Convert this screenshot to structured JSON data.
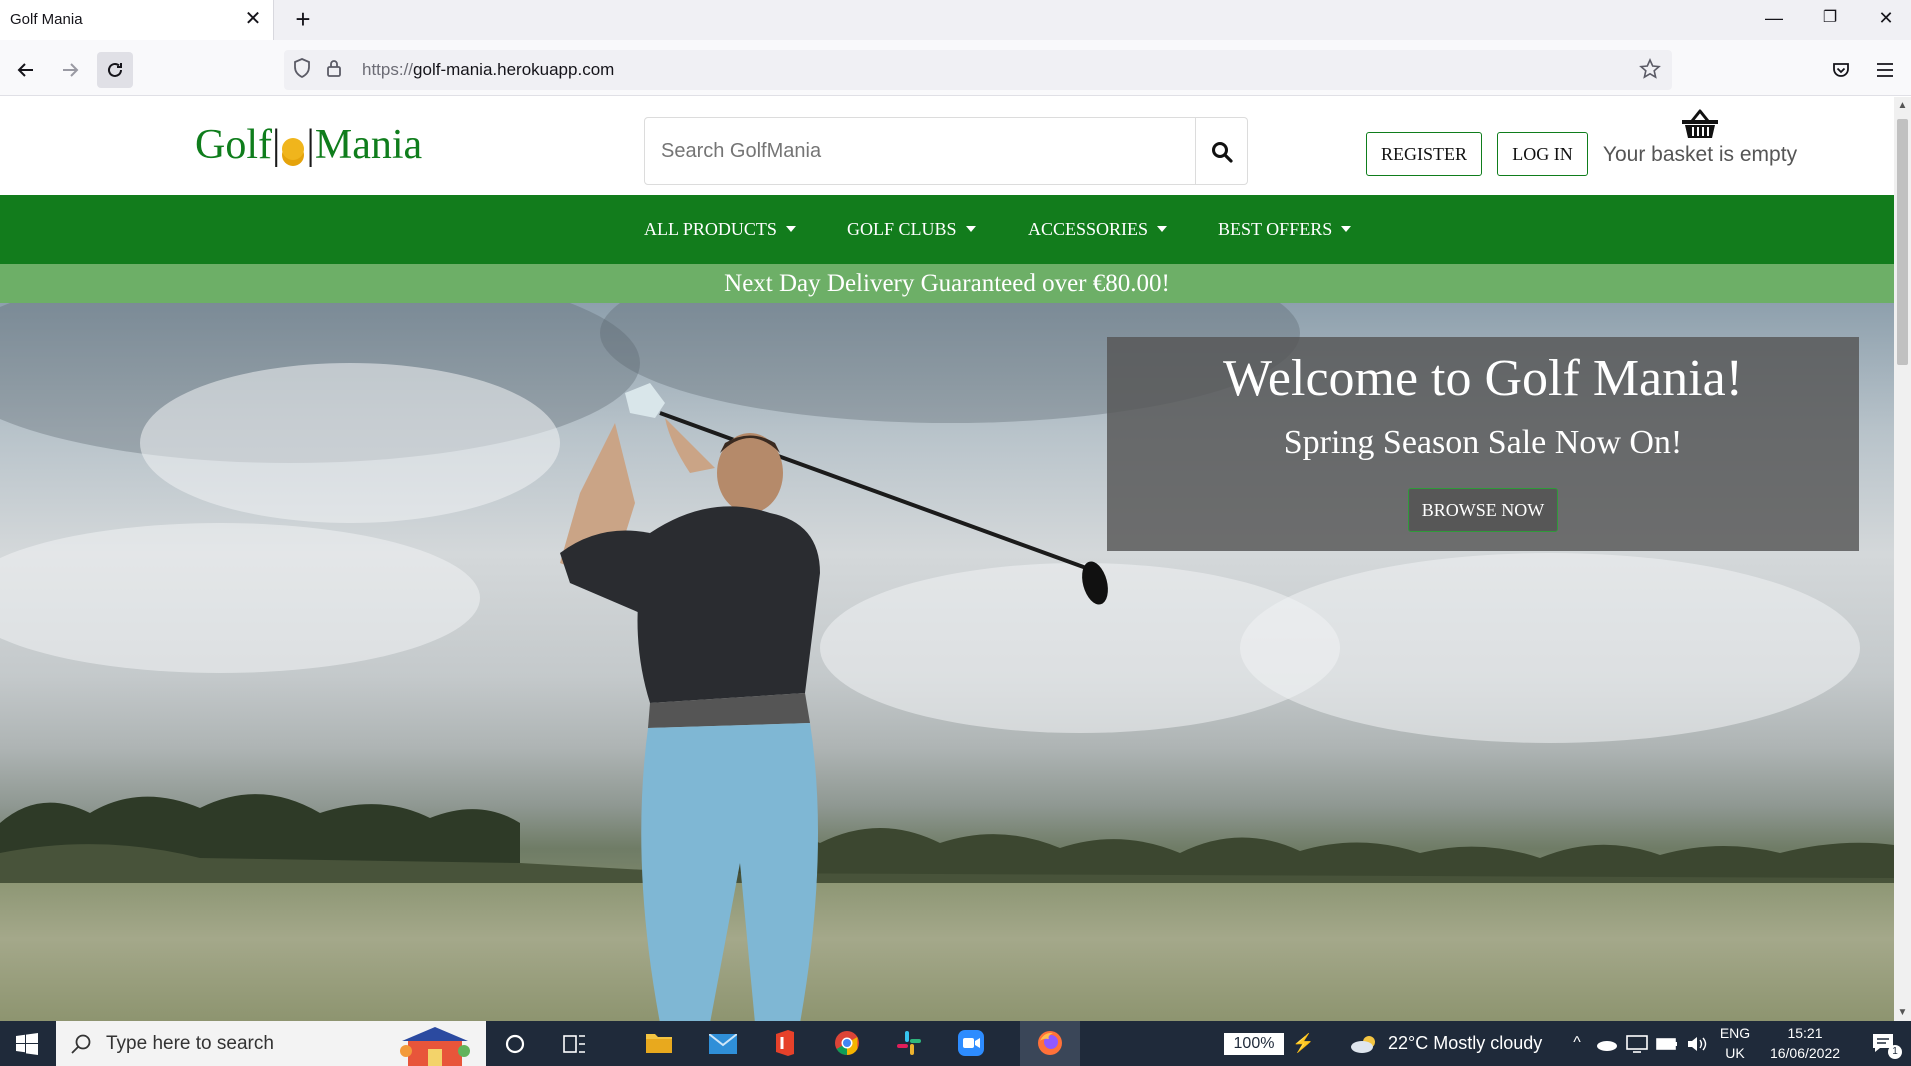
{
  "browser": {
    "tab_title": "Golf Mania",
    "tab_close": "✕",
    "new_tab": "+",
    "url_scheme": "https://",
    "url_host": "golf-mania.herokuapp.com",
    "window_controls": {
      "minimize": "—",
      "restore": "❐",
      "close": "✕"
    }
  },
  "site": {
    "logo_left": "Golf",
    "logo_right": "Mania",
    "search_placeholder": "Search GolfMania",
    "register_label": "REGISTER",
    "login_label": "LOG IN",
    "basket_text": "Your basket is empty",
    "nav": [
      {
        "label": "ALL PRODUCTS"
      },
      {
        "label": "GOLF CLUBS"
      },
      {
        "label": "ACCESSORIES"
      },
      {
        "label": "BEST OFFERS"
      }
    ],
    "delivery_banner": "Next Day Delivery Guaranteed over €80.00!",
    "hero": {
      "title": "Welcome to Golf Mania!",
      "subtitle": "Spring Season Sale Now On!",
      "cta": "BROWSE NOW"
    }
  },
  "taskbar": {
    "search_placeholder": "Type here to search",
    "battery": "100%",
    "weather": "22°C  Mostly cloudy",
    "lang_top": "ENG",
    "lang_bottom": "UK",
    "time": "15:21",
    "date": "16/06/2022",
    "notification_count": "1"
  },
  "colors": {
    "brand_green": "#127c1c",
    "delivery_green": "#6daf67",
    "taskbar": "#1f2a3a"
  }
}
